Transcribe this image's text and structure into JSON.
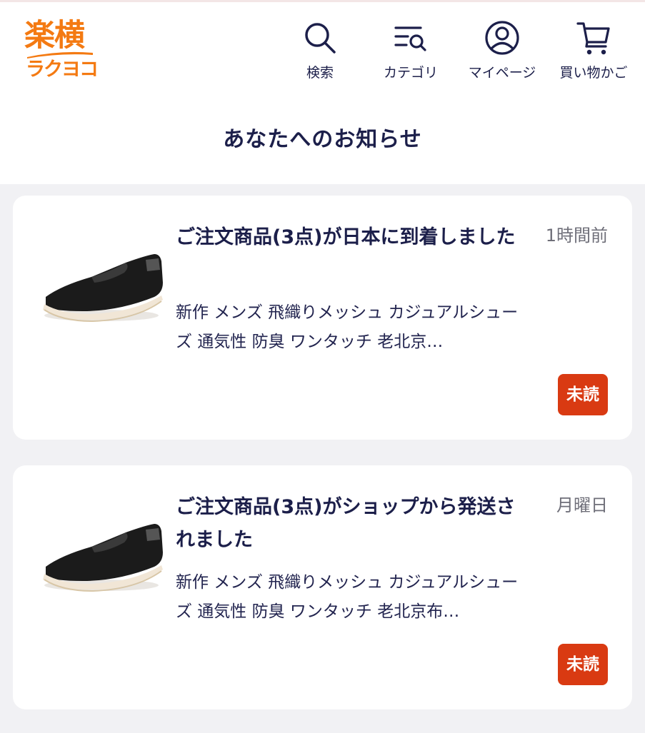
{
  "brand": {
    "logo_kanji": "楽横",
    "logo_kana": "ラクヨコ",
    "color": "#f47a12"
  },
  "nav": {
    "search_label": "検索",
    "category_label": "カテゴリ",
    "mypage_label": "マイページ",
    "cart_label": "買い物かご",
    "icons": [
      "search-icon",
      "category-search-icon",
      "user-icon",
      "cart-icon"
    ]
  },
  "page": {
    "title": "あなたへのお知らせ"
  },
  "notifications": [
    {
      "title": "ご注文商品(3点)が日本に到着しました",
      "time": "1時間前",
      "description": "新作 メンズ 飛織りメッシュ カジュアルシューズ 通気性 防臭 ワンタッチ 老北京…",
      "badge": "未読",
      "image": "black-slip-on-shoe"
    },
    {
      "title": "ご注文商品(3点)がショップから発送されました",
      "time": "月曜日",
      "description": "新作 メンズ 飛織りメッシュ カジュアルシューズ 通気性 防臭 ワンタッチ 老北京布…",
      "badge": "未読",
      "image": "black-slip-on-shoe"
    }
  ],
  "colors": {
    "text": "#1c1f4a",
    "badge": "#d93a12",
    "list_background": "#f1f1f4"
  }
}
